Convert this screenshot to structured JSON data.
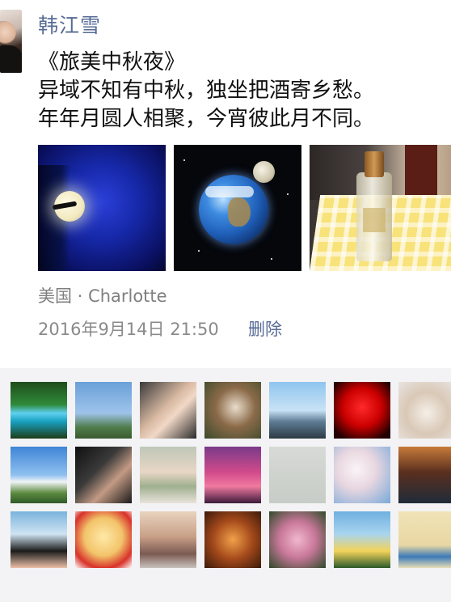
{
  "post": {
    "author": "韩江雪",
    "lines": [
      "《旅美中秋夜》",
      "异域不知有中秋，独坐把酒寄乡愁。",
      "年年月圆人相聚，今宵彼此月不同。"
    ],
    "location": "美国 · Charlotte",
    "timestamp": "2016年9月14日 21:50",
    "delete_label": "删除"
  },
  "photos": [
    {
      "icon": "moon-night-photo"
    },
    {
      "icon": "earth-moon-photo"
    },
    {
      "icon": "liquor-bottle-photo"
    }
  ],
  "colors": {
    "name_link": "#576b95",
    "meta_gray": "#8a8a8a",
    "likes_bg": "#f3f3f5"
  },
  "likes": [
    {
      "icon": "waterfall-avatar"
    },
    {
      "icon": "statue-of-liberty-avatar"
    },
    {
      "icon": "selfie-avatar"
    },
    {
      "icon": "owl-avatar"
    },
    {
      "icon": "beach-man-avatar"
    },
    {
      "icon": "red-rose-avatar"
    },
    {
      "icon": "fox-avatar"
    },
    {
      "icon": "sky-clouds-avatar"
    },
    {
      "icon": "woman-portrait-avatar"
    },
    {
      "icon": "woman-glasses-avatar"
    },
    {
      "icon": "sunset-avatar"
    },
    {
      "icon": "chinese-characters-avatar"
    },
    {
      "icon": "blossom-avatar"
    },
    {
      "icon": "forest-dusk-avatar"
    },
    {
      "icon": "woman-smiling-avatar"
    },
    {
      "icon": "monkey-avatar"
    },
    {
      "icon": "older-woman-avatar"
    },
    {
      "icon": "orchestra-avatar"
    },
    {
      "icon": "pink-flowers-avatar"
    },
    {
      "icon": "seaside-woman-avatar"
    },
    {
      "icon": "umbrella-cartoon-avatar"
    }
  ]
}
